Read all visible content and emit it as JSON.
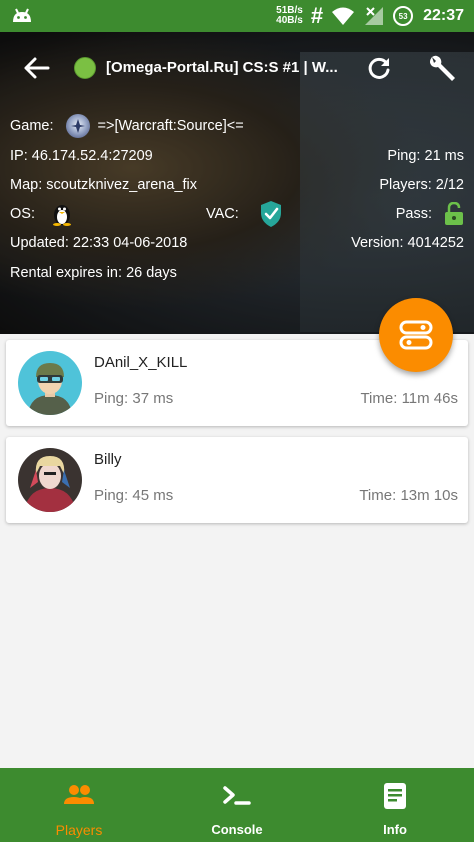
{
  "status_bar": {
    "upload_speed": "51B/s",
    "download_speed": "40B/s",
    "hash_symbol": "#",
    "badge": "53",
    "time": "22:37"
  },
  "header": {
    "server_title": "[Omega-Portal.Ru] CS:S #1 | W...",
    "online_color": "#7bc043",
    "game_label": "Game:",
    "game_value": "=>[Warcraft:Source]<=",
    "ip_label": "IP:",
    "ip_value": "46.174.52.4:27209",
    "ping_label": "Ping:",
    "ping_value": "21 ms",
    "map_label": "Map:",
    "map_value": "scoutzknivez_arena_fix",
    "players_label": "Players:",
    "players_value": "2/12",
    "os_label": "OS:",
    "os_icon": "linux-tux-icon",
    "vac_label": "VAC:",
    "vac_icon": "vac-shield-check-icon",
    "pass_label": "Pass:",
    "pass_icon": "lock-open-icon",
    "updated_label": "Updated:",
    "updated_value": "22:33 04-06-2018",
    "version_label": "Version:",
    "version_value": "4014252",
    "rental_label": "Rental expires in:",
    "rental_value": "26 days"
  },
  "players": [
    {
      "name": "DAnil_X_KILL",
      "ping_label": "Ping:",
      "ping_value": "37 ms",
      "time_label": "Time:",
      "time_value": "11m 46s"
    },
    {
      "name": "Billy",
      "ping_label": "Ping:",
      "ping_value": "45 ms",
      "time_label": "Time:",
      "time_value": "13m 10s"
    }
  ],
  "bottom_nav": {
    "items": [
      {
        "label": "Players",
        "icon": "people-icon",
        "active": true
      },
      {
        "label": "Console",
        "icon": "terminal-icon",
        "active": false
      },
      {
        "label": "Info",
        "icon": "document-icon",
        "active": false
      }
    ]
  },
  "colors": {
    "primary": "#3d8b2f",
    "accent": "#fb8c00"
  }
}
